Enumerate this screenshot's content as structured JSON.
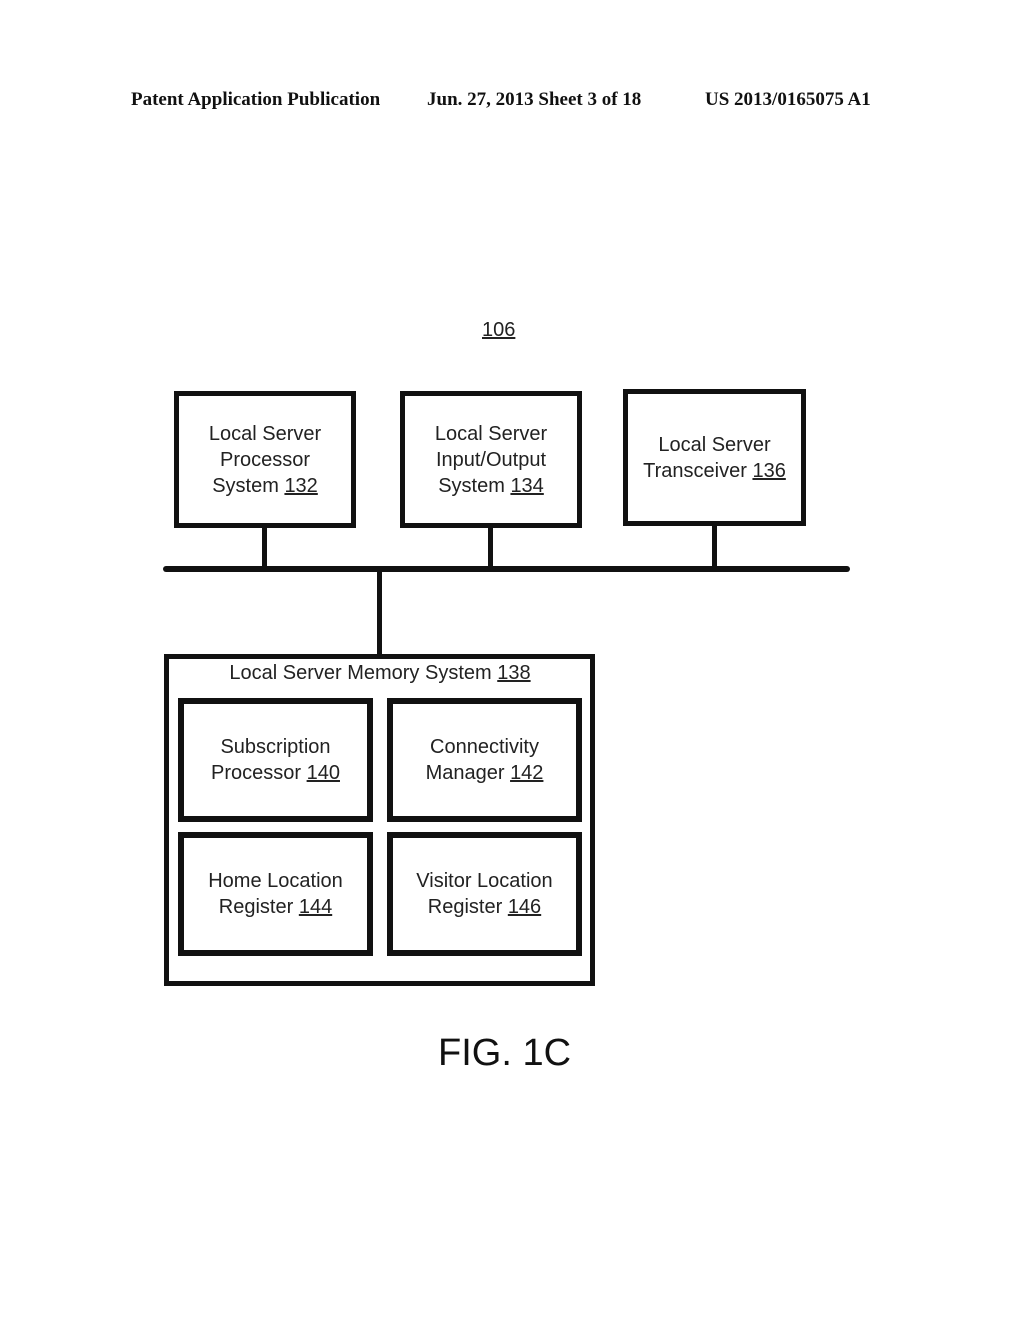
{
  "header": {
    "publication": "Patent Application Publication",
    "date_sheet": "Jun. 27, 2013  Sheet 3 of 18",
    "patent_number": "US 2013/0165075 A1"
  },
  "diagram": {
    "id": "106",
    "top_blocks": [
      {
        "lines": [
          "Local Server",
          "Processor",
          "System "
        ],
        "ref": "132"
      },
      {
        "lines": [
          "Local Server",
          "Input/Output",
          "System "
        ],
        "ref": "134"
      },
      {
        "lines": [
          "Local Server",
          "Transceiver "
        ],
        "ref": "136"
      }
    ],
    "memory_system": {
      "title": "Local Server Memory System ",
      "ref": "138",
      "blocks": [
        {
          "lines": [
            "Subscription",
            "Processor "
          ],
          "ref": "140"
        },
        {
          "lines": [
            "Connectivity",
            "Manager "
          ],
          "ref": "142"
        },
        {
          "lines": [
            "Home Location",
            "Register "
          ],
          "ref": "144"
        },
        {
          "lines": [
            "Visitor Location",
            "Register "
          ],
          "ref": "146"
        }
      ]
    }
  },
  "figure_label": "FIG. 1C"
}
